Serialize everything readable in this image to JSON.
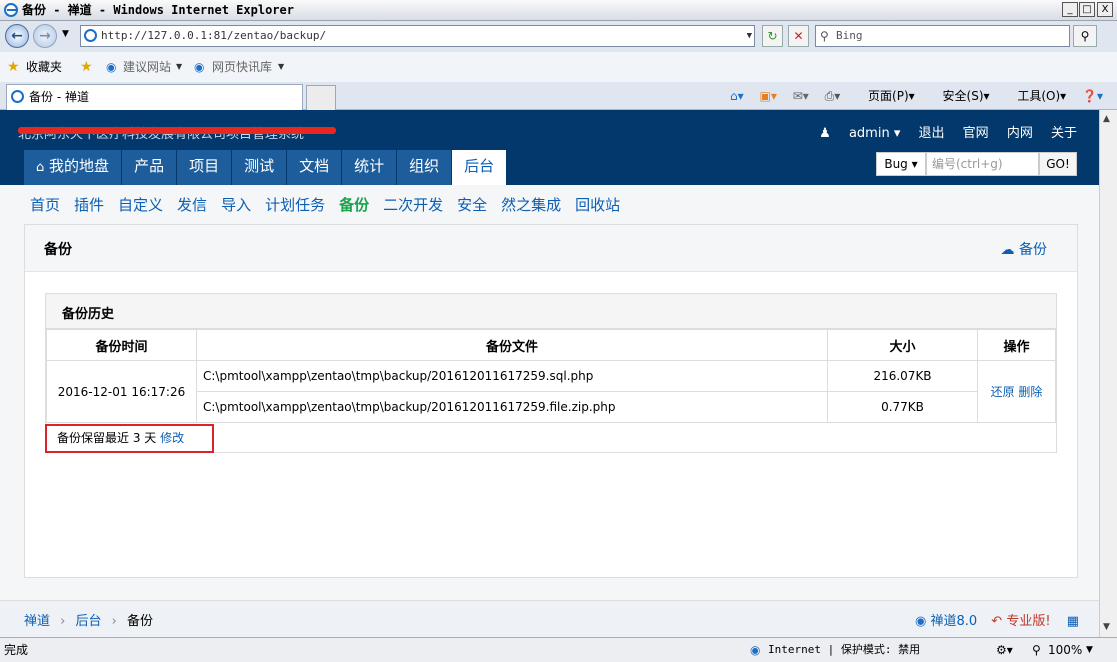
{
  "window": {
    "title": "备份 - 禅道 - Windows Internet Explorer",
    "minimize": "_",
    "maximize": "□",
    "close": "X"
  },
  "toolbar": {
    "address": "http://127.0.0.1:81/zentao/backup/",
    "search_placeholder": "Bing"
  },
  "favorites": {
    "label": "收藏夹",
    "items": [
      "建议网站",
      "网页快讯库"
    ]
  },
  "browser_tab": {
    "label": "备份 - 禅道"
  },
  "command_bar": {
    "page": "页面(P)",
    "safety": "安全(S)",
    "tools": "工具(O)"
  },
  "app": {
    "company": "北京阿东天下医疗科技发展有限公司项目管理系统",
    "user": "admin",
    "top_links": [
      "退出",
      "官网",
      "内网",
      "关于"
    ],
    "main_nav": [
      {
        "label": "我的地盘",
        "active": false
      },
      {
        "label": "产品",
        "active": false
      },
      {
        "label": "项目",
        "active": false
      },
      {
        "label": "测试",
        "active": false
      },
      {
        "label": "文档",
        "active": false
      },
      {
        "label": "统计",
        "active": false
      },
      {
        "label": "组织",
        "active": false
      },
      {
        "label": "后台",
        "active": true
      }
    ],
    "search": {
      "type": "Bug",
      "placeholder": "编号(ctrl+g)",
      "go": "GO!"
    },
    "sub_nav": [
      {
        "label": "首页",
        "active": false
      },
      {
        "label": "插件",
        "active": false
      },
      {
        "label": "自定义",
        "active": false
      },
      {
        "label": "发信",
        "active": false
      },
      {
        "label": "导入",
        "active": false
      },
      {
        "label": "计划任务",
        "active": false
      },
      {
        "label": "备份",
        "active": true
      },
      {
        "label": "二次开发",
        "active": false
      },
      {
        "label": "安全",
        "active": false
      },
      {
        "label": "然之集成",
        "active": false
      },
      {
        "label": "回收站",
        "active": false
      }
    ]
  },
  "panel": {
    "title": "备份",
    "action": "备份",
    "history_title": "备份历史",
    "columns": [
      "备份时间",
      "备份文件",
      "大小",
      "操作"
    ],
    "row": {
      "time": "2016-12-01 16:17:26",
      "files": [
        {
          "path": "C:\\pmtool\\xampp\\zentao\\tmp\\backup/201612011617259.sql.php",
          "size": "216.07KB"
        },
        {
          "path": "C:\\pmtool\\xampp\\zentao\\tmp\\backup/201612011617259.file.zip.php",
          "size": "0.77KB"
        }
      ],
      "actions": [
        "还原",
        "删除"
      ]
    },
    "note_text": "备份保留最近 3 天",
    "note_link": "修改"
  },
  "footer": {
    "breadcrumb": [
      "禅道",
      "后台",
      "备份"
    ],
    "version": "禅道8.0",
    "pro": "专业版!"
  },
  "statusbar": {
    "left": "完成",
    "zone": "Internet | 保护模式: 禁用",
    "zoom": "100%"
  }
}
